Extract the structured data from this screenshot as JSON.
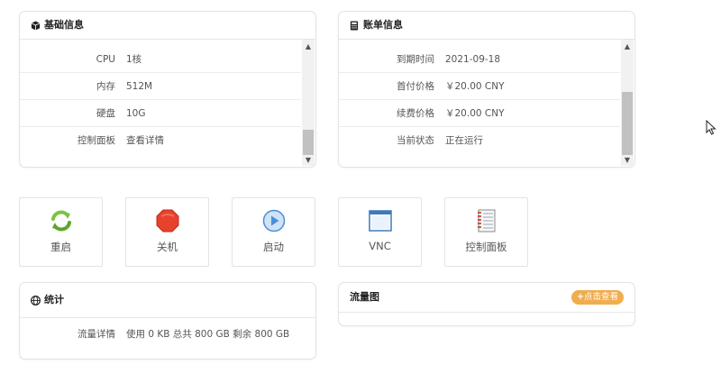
{
  "basic_info": {
    "title": "基础信息",
    "icon": "cube-icon",
    "rows": [
      {
        "label": "CPU",
        "value": "1核"
      },
      {
        "label": "内存",
        "value": "512M"
      },
      {
        "label": "硬盘",
        "value": "10G"
      },
      {
        "label": "控制面板",
        "value": "查看详情"
      }
    ]
  },
  "billing_info": {
    "title": "账单信息",
    "icon": "calculator-icon",
    "rows": [
      {
        "label": "到期时间",
        "value": "2021-09-18"
      },
      {
        "label": "首付价格",
        "value": "￥20.00 CNY"
      },
      {
        "label": "续费价格",
        "value": "￥20.00 CNY"
      },
      {
        "label": "当前状态",
        "value": "正在运行"
      }
    ]
  },
  "actions": [
    {
      "label": "重启",
      "icon": "restart-icon"
    },
    {
      "label": "关机",
      "icon": "stop-icon"
    },
    {
      "label": "启动",
      "icon": "play-icon"
    },
    {
      "label": "VNC",
      "icon": "window-icon"
    },
    {
      "label": "控制面板",
      "icon": "notebook-icon"
    }
  ],
  "stats": {
    "title": "统计",
    "icon": "globe-icon",
    "rows": [
      {
        "label": "流量详情",
        "value": "使用 0 KB 总共 800 GB 剩余 800 GB"
      }
    ]
  },
  "traffic_chart": {
    "title": "流量图",
    "button_label": "点击查看"
  },
  "colors": {
    "accent_orange": "#f0ad4e",
    "restart_green": "#7cc242",
    "stop_red": "#e8412c",
    "play_blue": "#4a8fd8"
  }
}
